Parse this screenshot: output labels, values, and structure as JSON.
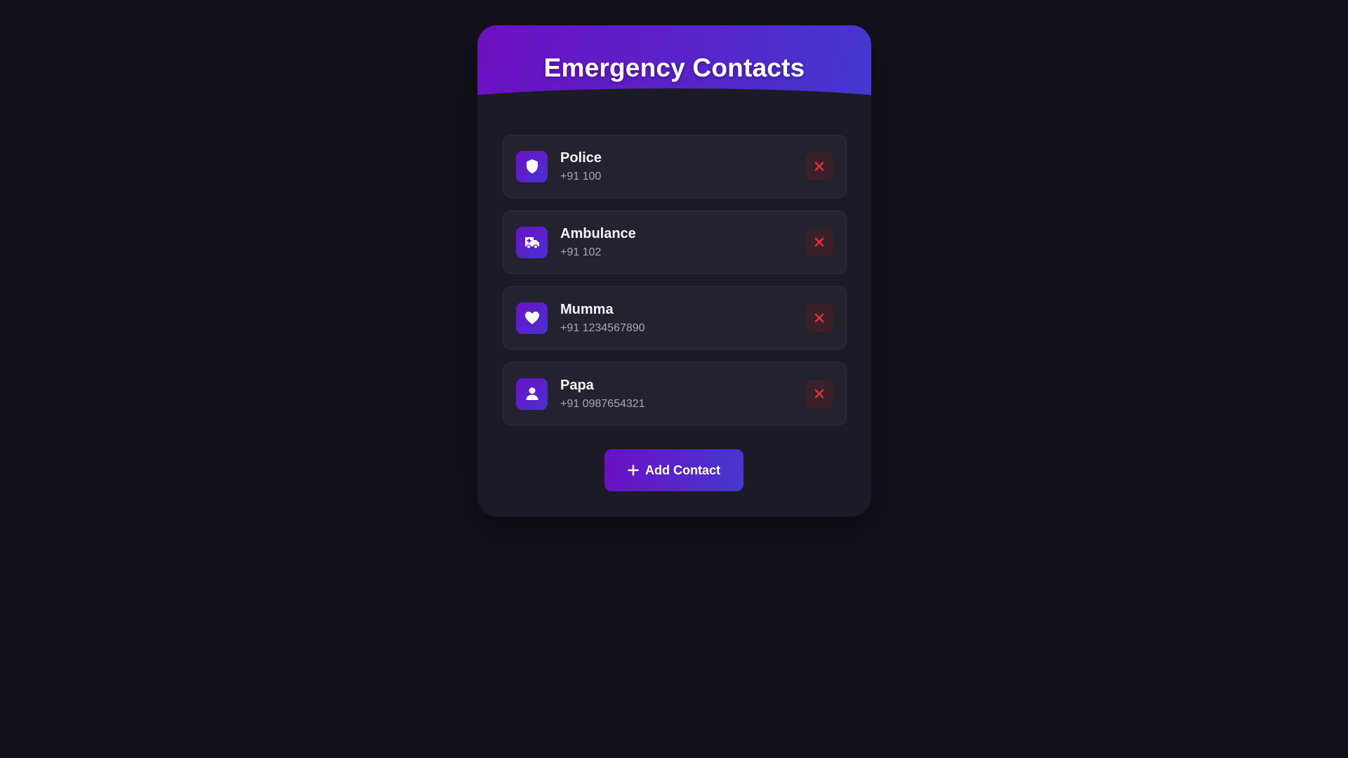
{
  "header": {
    "title": "Emergency Contacts"
  },
  "contacts": [
    {
      "name": "Police",
      "phone": "+91 100",
      "icon": "shield-icon"
    },
    {
      "name": "Ambulance",
      "phone": "+91 102",
      "icon": "ambulance-icon"
    },
    {
      "name": "Mumma",
      "phone": "+91 1234567890",
      "icon": "heart-icon"
    },
    {
      "name": "Papa",
      "phone": "+91 0987654321",
      "icon": "person-icon"
    }
  ],
  "actions": {
    "add_label": "Add Contact",
    "add_icon": "plus-icon",
    "delete_icon": "close-icon"
  },
  "colors": {
    "background": "#13121c",
    "card": "#1b1a26",
    "accent_start": "#6d10c0",
    "accent_end": "#4338cf",
    "delete": "#e0303f"
  }
}
